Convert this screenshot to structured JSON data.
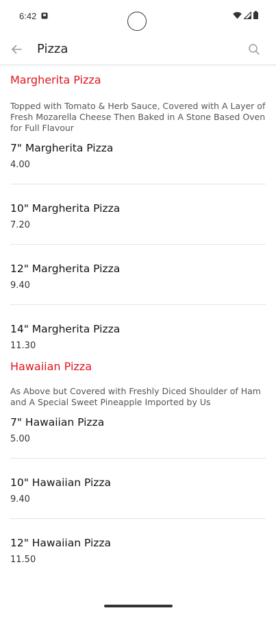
{
  "status_bar": {
    "time": "6:42"
  },
  "app_bar": {
    "title": "Pizza"
  },
  "categories": [
    {
      "title": "Margherita Pizza",
      "description": "Topped with Tomato & Herb Sauce, Covered with A Layer of Fresh Mozarella Cheese Then Baked in A Stone Based Oven for Full Flavour",
      "items": [
        {
          "name": "7\" Margherita Pizza",
          "price": "4.00"
        },
        {
          "name": "10\" Margherita Pizza",
          "price": "7.20"
        },
        {
          "name": "12\" Margherita Pizza",
          "price": "9.40"
        },
        {
          "name": "14\" Margherita Pizza",
          "price": "11.30"
        }
      ]
    },
    {
      "title": "Hawaiian Pizza",
      "description": "As Above but Covered with Freshly Diced Shoulder of Ham and A Special Sweet Pineapple Imported by Us",
      "items": [
        {
          "name": "7\" Hawaiian Pizza",
          "price": "5.00"
        },
        {
          "name": "10\" Hawaiian Pizza",
          "price": "9.40"
        },
        {
          "name": "12\" Hawaiian Pizza",
          "price": "11.50"
        }
      ]
    }
  ],
  "colors": {
    "accent": "#e0141b",
    "divider": "#e4e4e4"
  },
  "icons": {
    "back": "arrow-back-icon",
    "search": "search-icon",
    "wifi": "wifi-icon",
    "signal": "signal-icon",
    "battery": "battery-icon"
  }
}
